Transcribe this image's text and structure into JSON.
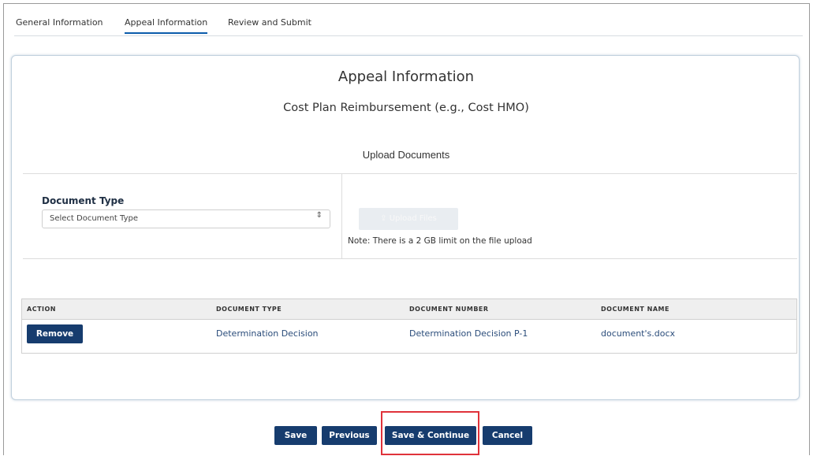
{
  "tabs": {
    "general": "General Information",
    "appeal": "Appeal Information",
    "review": "Review and Submit"
  },
  "card": {
    "title": "Appeal Information",
    "subtitle": "Cost Plan Reimbursement (e.g., Cost HMO)",
    "upload_heading": "Upload Documents"
  },
  "document_type": {
    "label": "Document Type",
    "placeholder": "Select Document Type",
    "caret": "⇕"
  },
  "upload": {
    "button_label": "⇪ Upload Files",
    "note": "Note: There is a 2 GB limit on the file upload"
  },
  "table": {
    "headers": [
      "ACTION",
      "DOCUMENT TYPE",
      "DOCUMENT NUMBER",
      "DOCUMENT NAME"
    ],
    "rows": [
      {
        "action_label": "Remove",
        "document_type": "Determination Decision",
        "document_number": "Determination Decision P-1",
        "document_name": "document's.docx"
      }
    ]
  },
  "actions": {
    "save": "Save",
    "previous": "Previous",
    "save_continue": "Save & Continue",
    "cancel": "Cancel"
  },
  "colors": {
    "primary_button": "#163c6e",
    "active_tab_underline": "#0b5cab",
    "highlight_box": "#e0323a"
  }
}
